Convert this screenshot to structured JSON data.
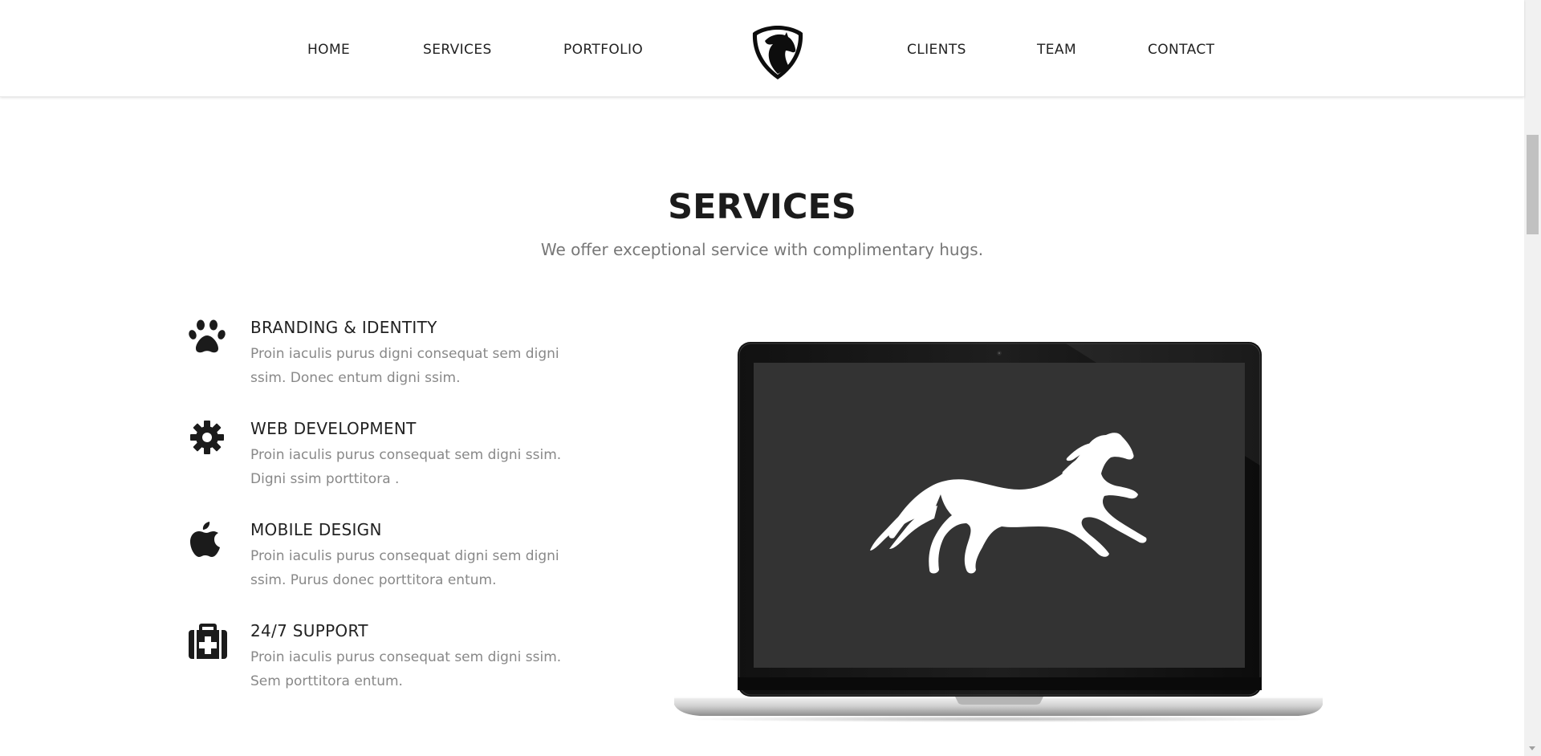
{
  "nav": {
    "items": [
      {
        "label": "HOME"
      },
      {
        "label": "SERVICES"
      },
      {
        "label": "PORTFOLIO"
      },
      {
        "label": "CLIENTS"
      },
      {
        "label": "TEAM"
      },
      {
        "label": "CONTACT"
      }
    ],
    "logo_icon": "horse-head-shield-icon"
  },
  "section": {
    "title": "SERVICES",
    "subtitle": "We offer exceptional service with complimentary hugs."
  },
  "services": [
    {
      "icon": "paw-icon",
      "title": "BRANDING & IDENTITY",
      "description": "Proin iaculis purus digni consequat sem digni ssim. Donec entum digni ssim."
    },
    {
      "icon": "gear-icon",
      "title": "WEB DEVELOPMENT",
      "description": "Proin iaculis purus consequat sem digni ssim. Digni ssim porttitora ."
    },
    {
      "icon": "apple-icon",
      "title": "MOBILE DESIGN",
      "description": "Proin iaculis purus consequat digni sem digni ssim. Purus donec porttitora entum."
    },
    {
      "icon": "medkit-icon",
      "title": "24/7 SUPPORT",
      "description": "Proin iaculis purus consequat sem digni ssim. Sem porttitora entum."
    }
  ],
  "showcase": {
    "device": "laptop",
    "screen_image": "running-horse-silhouette"
  },
  "colors": {
    "text_dark": "#1b1b1b",
    "text_muted": "#888888",
    "screen_bg": "#333333",
    "background": "#ffffff"
  }
}
